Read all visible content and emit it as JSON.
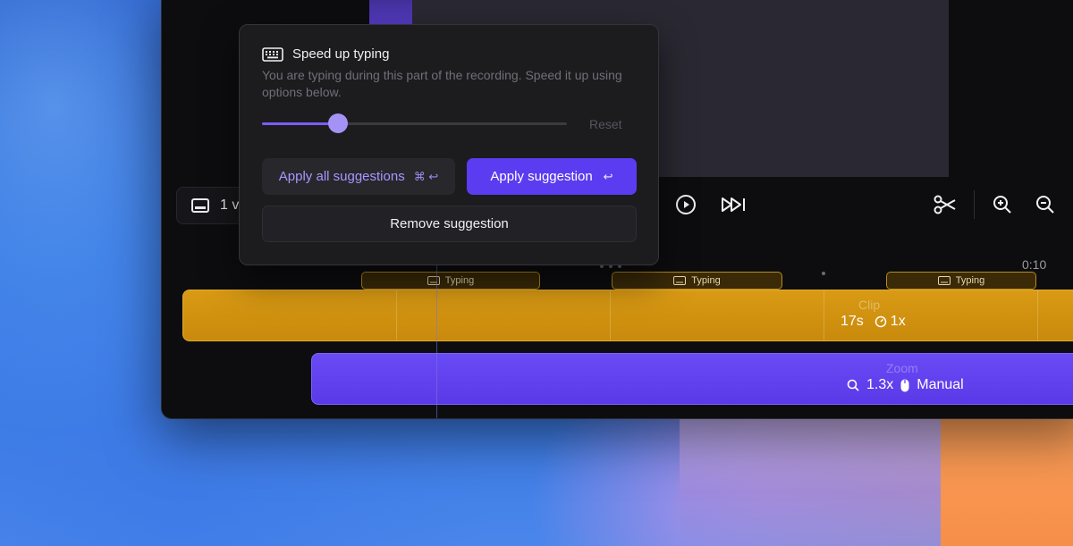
{
  "popover": {
    "title": "Speed up typing",
    "description": "You are typing during this part of the recording. Speed it up using options below.",
    "slider_value": 0.25,
    "reset_label": "Reset",
    "apply_all_label": "Apply all suggestions",
    "apply_all_shortcut": "⌘ ↩",
    "apply_label": "Apply suggestion",
    "apply_shortcut": "↩",
    "remove_label": "Remove suggestion"
  },
  "controls": {
    "layout_label": "1 vi"
  },
  "timeline": {
    "ruler_time": "0:10",
    "typing_chips": [
      "Typing",
      "Typing",
      "Typing"
    ],
    "clip": {
      "title": "Clip",
      "duration": "17s",
      "speed": "1x"
    },
    "zoom": {
      "title": "Zoom",
      "level": "1.3x",
      "mode": "Manual"
    }
  },
  "colors": {
    "accent": "#5b3cf0",
    "clip": "#d99a14",
    "zoom": "#6a4af4"
  }
}
